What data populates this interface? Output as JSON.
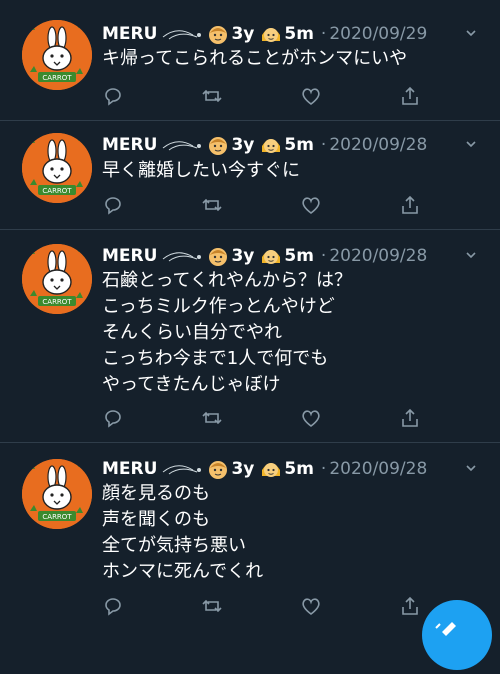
{
  "tweets": [
    {
      "name": "MERU",
      "age1": "3y",
      "age2": "5m",
      "separator": "·",
      "date": "2020/09/29",
      "text": "キ帰ってこられることがホンマにいや"
    },
    {
      "name": "MERU",
      "age1": "3y",
      "age2": "5m",
      "separator": "·",
      "date": "2020/09/28",
      "text": "早く離婚したい今すぐに"
    },
    {
      "name": "MERU",
      "age1": "3y",
      "age2": "5m",
      "separator": "·",
      "date": "2020/09/28",
      "text": "石鹸とってくれやんから？は？\nこっちミルク作っとんやけど\nそんくらい自分でやれ\nこっちわ今まで1人で何でも\nやってきたんじゃぼけ"
    },
    {
      "name": "MERU",
      "age1": "3y",
      "age2": "5m",
      "separator": "·",
      "date": "2020/09/28",
      "text": "顔を見るのも\n声を聞くのも\n全てが気持ち悪い\nホンマに死んでくれ"
    }
  ],
  "avatar_label": "CARROT",
  "icons": {
    "reply": "reply-icon",
    "retweet": "retweet-icon",
    "like": "like-icon",
    "share": "share-icon",
    "more": "chevron-down-icon",
    "compose": "compose-icon"
  },
  "colors": {
    "background": "#15202b",
    "secondary_text": "#8899a6",
    "divider": "#2f3d4a",
    "accent": "#1da1f2",
    "avatar_orange": "#e86d1f"
  }
}
